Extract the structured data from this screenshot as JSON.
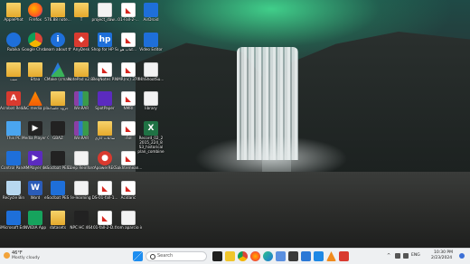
{
  "taskbar": {
    "weather_temp": "46°F",
    "weather_condition": "Mostly cloudy",
    "search_placeholder": "Search",
    "language": "ENG",
    "time": "10:30 PM",
    "date": "2/23/2024",
    "pinned_apps": [
      "file-explorer",
      "chrome",
      "firefox",
      "edge",
      "store",
      "mail",
      "vscode",
      "terminal",
      "notepad",
      "vlc",
      "other"
    ]
  },
  "desktop_icons": {
    "col1": [
      {
        "name": "ApplePhot",
        "icon": "folder-icon"
      },
      {
        "name": "Rubika",
        "icon": "rubika-icon"
      },
      {
        "name": "ننبب",
        "icon": "folder-icon"
      },
      {
        "name": "Acrobat Reader",
        "icon": "acrobat-icon"
      },
      {
        "name": "This PC",
        "icon": "pc-icon"
      },
      {
        "name": "Control Panel",
        "icon": "control-panel-icon"
      },
      {
        "name": "Recycle Bin",
        "icon": "recycle-bin-icon"
      },
      {
        "name": "iMicrosoft Ed...",
        "icon": "app-icon"
      }
    ],
    "col2": [
      {
        "name": "Firefox",
        "icon": "firefox-icon"
      },
      {
        "name": "Google Chrome",
        "icon": "chrome-icon"
      },
      {
        "name": "Eltaa",
        "icon": "folder-icon"
      },
      {
        "name": "VLC media player",
        "icon": "vlc-icon"
      },
      {
        "name": "Media Player Classic",
        "icon": "media-player-icon"
      },
      {
        "name": "XMPlayer 4K",
        "icon": "xmplayer-icon"
      },
      {
        "name": "Word",
        "icon": "word-icon"
      },
      {
        "name": "NVIDIA App",
        "icon": "nvidia-icon"
      }
    ],
    "col3": [
      {
        "name": "576.88 note...",
        "icon": "folder-icon"
      },
      {
        "name": "Learn about this picture",
        "icon": "info-icon"
      },
      {
        "name": "CMake (cmake-gui)",
        "icon": "cmake-icon"
      },
      {
        "name": "جزوه جلسات",
        "icon": "folder-icon"
      },
      {
        "name": "GBAZ",
        "icon": "app-icon"
      },
      {
        "name": "eSoclbat PES 2021 Update",
        "icon": "app-icon"
      },
      {
        "name": "eSoclbat PES Settings",
        "icon": "app-icon"
      },
      {
        "name": "datasets",
        "icon": "folder-icon"
      }
    ],
    "col4": [
      {
        "name": "T",
        "icon": "folder-icon"
      },
      {
        "name": "AnyDesk",
        "icon": "anydesk-icon"
      },
      {
        "name": "NotePad v2.8...",
        "icon": "folder-icon"
      },
      {
        "name": "WinRAR",
        "icon": "winrar-icon"
      },
      {
        "name": "WinRAR",
        "icon": "winrar-icon"
      },
      {
        "name": "Deep Reinforce...",
        "icon": "document-icon"
      },
      {
        "name": "e-learning",
        "icon": "document-icon"
      },
      {
        "name": "NPC HC 464",
        "icon": "app-icon"
      }
    ],
    "col5": [
      {
        "name": "project_daw...",
        "icon": "document-icon"
      },
      {
        "name": "Shop for HP Supplies",
        "icon": "hp-icon"
      },
      {
        "name": "ReqNotes P...",
        "icon": "pdf-icon"
      },
      {
        "name": "SpotPaper",
        "icon": "spotpaper-icon"
      },
      {
        "name": "ساعات کاری",
        "icon": "folder-icon"
      },
      {
        "name": "ApowerREC",
        "icon": "apowerrec-icon"
      },
      {
        "name": "DS-01-fall-1...",
        "icon": "pdf-icon"
      },
      {
        "name": "01-fall-2-D...",
        "icon": "pdf-icon"
      }
    ],
    "col6": [
      {
        "name": "01-Fall-2-...",
        "icon": "pdf-icon"
      },
      {
        "name": "کتاب هو...",
        "icon": "pdf-icon"
      },
      {
        "name": "NMR(nc) 370 Solido 1",
        "icon": "pdf-icon"
      },
      {
        "name": "NMRI",
        "icon": "pdf-icon"
      },
      {
        "name": "iFol",
        "icon": "pdf-icon"
      },
      {
        "name": "Sakhtemean...",
        "icon": "pdf-icon"
      },
      {
        "name": "Acidaric",
        "icon": "pdf-icon"
      },
      {
        "name": "from aparcio import sleep",
        "icon": "document-icon"
      }
    ],
    "col7": [
      {
        "name": "AirDroid",
        "icon": "airdroid-icon"
      },
      {
        "name": "Video Editor",
        "icon": "video-editor-icon"
      },
      {
        "name": "fishShootSu...",
        "icon": "document-icon"
      },
      {
        "name": "library",
        "icon": "document-icon"
      },
      {
        "name": "Record_02_2 2015_224_8 S3_historical plan_combine ...",
        "icon": "excel-icon"
      }
    ]
  }
}
